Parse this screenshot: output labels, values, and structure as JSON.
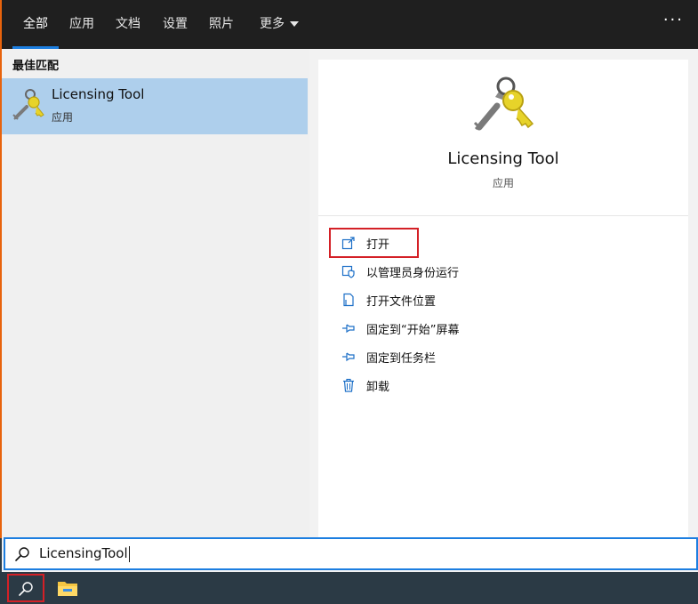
{
  "tabs": [
    {
      "label": "全部"
    },
    {
      "label": "应用"
    },
    {
      "label": "文档"
    },
    {
      "label": "设置"
    },
    {
      "label": "照片"
    },
    {
      "label": "更多"
    }
  ],
  "more_menu": "···",
  "best_match": {
    "section_title": "最佳匹配",
    "name": "Licensing Tool",
    "kind": "应用"
  },
  "details": {
    "name": "Licensing Tool",
    "kind": "应用",
    "actions": [
      {
        "label": "打开",
        "icon": "open-icon"
      },
      {
        "label": "以管理员身份运行",
        "icon": "shield-admin-icon"
      },
      {
        "label": "打开文件位置",
        "icon": "file-location-icon"
      },
      {
        "label": "固定到“开始”屏幕",
        "icon": "pin-icon"
      },
      {
        "label": "固定到任务栏",
        "icon": "pin-icon"
      },
      {
        "label": "卸载",
        "icon": "trash-icon"
      }
    ]
  },
  "search": {
    "value": "LicensingTool",
    "icon": "search-icon"
  },
  "taskbar": {
    "items": [
      {
        "icon": "search-icon"
      },
      {
        "icon": "file-explorer-icon"
      }
    ]
  },
  "colors": {
    "accent": "#1c7ee0",
    "selection": "#aecfec",
    "highlight_box": "#d42026",
    "taskbar": "#2b3a45",
    "top_bar": "#1f1f1f"
  }
}
